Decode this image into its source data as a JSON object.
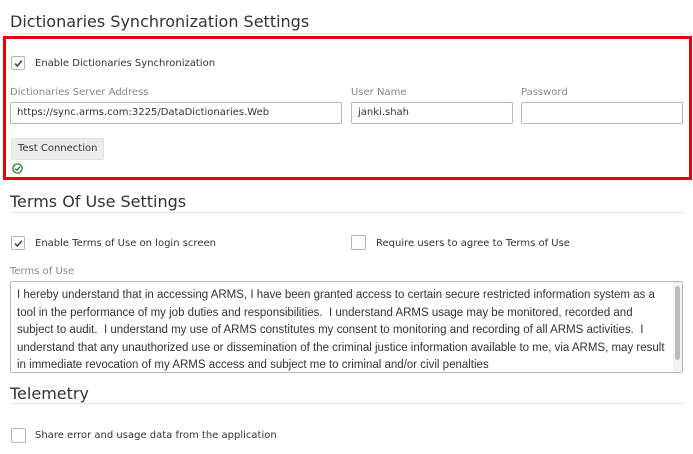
{
  "dict_sync": {
    "title": "Dictionaries Synchronization Settings",
    "enable_label": "Enable Dictionaries Synchronization",
    "enable_checked": true,
    "server_label": "Dictionaries Server Address",
    "server_value": "https://sync.arms.com:3225/DataDictionaries.Web",
    "user_label": "User Name",
    "user_value": "janki.shah",
    "password_label": "Password",
    "password_value": "",
    "test_button": "Test Connection",
    "status_icon": "check-circle-icon",
    "status_color": "#2e7d32",
    "highlight_color": "#e8000b"
  },
  "terms": {
    "title": "Terms Of Use Settings",
    "enable_label": "Enable Terms of Use on login screen",
    "enable_checked": true,
    "require_label": "Require users to agree to Terms of Use",
    "require_checked": false,
    "text_label": "Terms of Use",
    "text": "I hereby understand that in accessing ARMS, I have been granted access to certain secure restricted information system as a tool in the performance of my job duties and responsibilities.  I understand ARMS usage may be monitored, recorded and subject to audit.  I understand my use of ARMS constitutes my consent to monitoring and recording of all ARMS activities.  I understand that any unauthorized use or dissemination of the criminal justice information available to me, via ARMS, may result in immediate revocation of my ARMS access and subject me to criminal and/or civil penalties"
  },
  "telemetry": {
    "title": "Telemetry",
    "share_label": "Share error and usage data from the application",
    "share_checked": false
  }
}
